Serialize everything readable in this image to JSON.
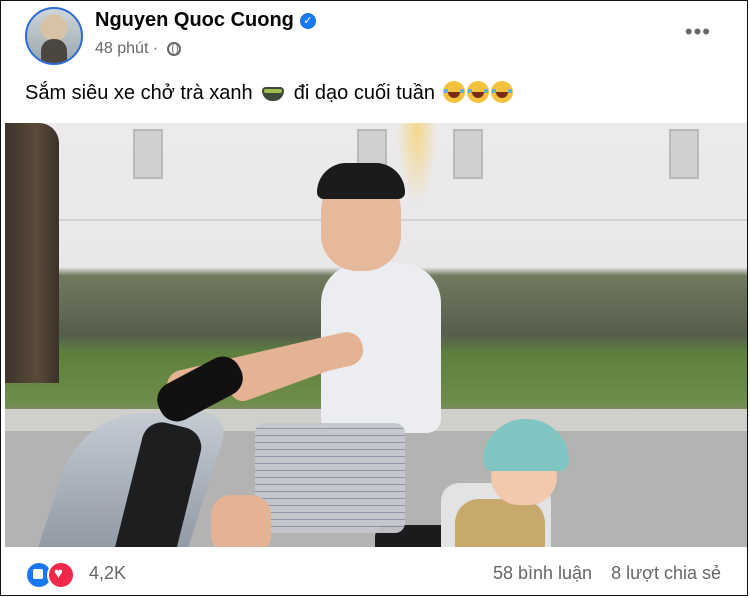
{
  "post": {
    "author": "Nguyen Quoc Cuong",
    "time": "48 phút · ",
    "caption": "Sắm siêu xe chở trà xanh",
    "caption_tail": "đi dạo cuối tuần",
    "reactions_count": "4,2K",
    "comments": "58 bình luận",
    "shares": "8 lượt chia sẻ",
    "more_icon": "more-horizontal-icon",
    "privacy_icon": "globe-icon",
    "accent_color": "#1877f2"
  }
}
